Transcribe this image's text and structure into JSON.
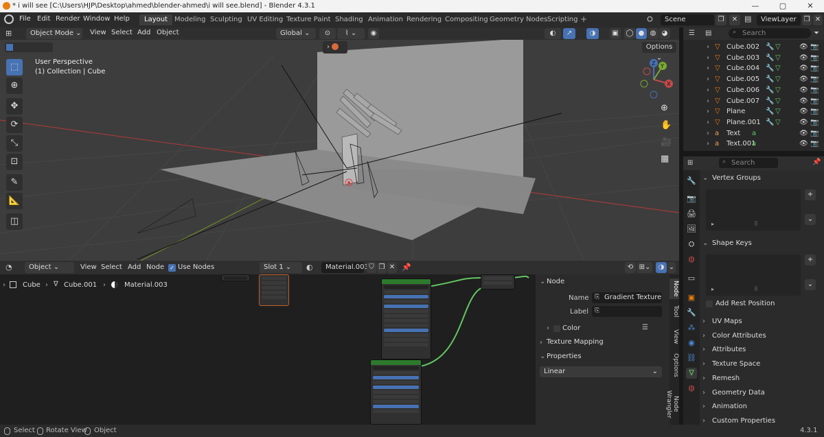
{
  "window": {
    "title": "* i will see [C:\\Users\\HJP\\Desktop\\ahmed\\blender-ahmed\\i will see.blend] - Blender 4.3.1",
    "minimize_glyph": "—",
    "maximize_glyph": "▢",
    "close_glyph": "✕"
  },
  "menu": [
    "File",
    "Edit",
    "Render",
    "Window",
    "Help"
  ],
  "workspaces": [
    "Layout",
    "Modeling",
    "Sculpting",
    "UV Editing",
    "Texture Paint",
    "Shading",
    "Animation",
    "Rendering",
    "Compositing",
    "Geometry Nodes",
    "Scripting"
  ],
  "add_workspace_glyph": "+",
  "scene": {
    "name": "Scene"
  },
  "view_layer": {
    "name": "ViewLayer"
  },
  "viewport": {
    "mode": "Object Mode",
    "menus": [
      "View",
      "Select",
      "Add",
      "Object"
    ],
    "transform_orientation": "Global",
    "view_name": "User Perspective",
    "collection_info": "(1) Collection | Cube",
    "options_label": "Options",
    "gizmo_axes": {
      "z": "Z",
      "y": "Y",
      "x": "X"
    },
    "colors": {
      "background": "#3d3d3d",
      "floor": "#8a8a8a",
      "wall": "#9a9a9a",
      "x_axis": "#a13a3a",
      "y_axis": "#6a8a2a"
    }
  },
  "node_editor": {
    "object_type": "Object",
    "menus": [
      "View",
      "Select",
      "Add",
      "Node"
    ],
    "use_nodes_label": "Use Nodes",
    "slot": "Slot 1",
    "material": "Material.003",
    "breadcrumb": [
      "Cube",
      "Cube.001",
      "Material.003"
    ]
  },
  "node_panel": {
    "tabs": [
      "Node",
      "Tool",
      "View",
      "Options",
      "Node Wrangler"
    ],
    "section_node": "Node",
    "name_label": "Name",
    "name_value": "Gradient Texture",
    "label_label": "Label",
    "label_value": "",
    "color_label": "Color",
    "texture_mapping": "Texture Mapping",
    "properties": "Properties",
    "gradient_type": "Linear"
  },
  "outliner": {
    "search_placeholder": "Search",
    "items": [
      {
        "name": "Cube.002",
        "type": "mesh"
      },
      {
        "name": "Cube.003",
        "type": "mesh"
      },
      {
        "name": "Cube.004",
        "type": "mesh"
      },
      {
        "name": "Cube.005",
        "type": "mesh"
      },
      {
        "name": "Cube.006",
        "type": "mesh"
      },
      {
        "name": "Cube.007",
        "type": "mesh"
      },
      {
        "name": "Plane",
        "type": "mesh"
      },
      {
        "name": "Plane.001",
        "type": "mesh"
      },
      {
        "name": "Text",
        "type": "text"
      },
      {
        "name": "Text.001",
        "type": "text"
      }
    ]
  },
  "properties": {
    "search_placeholder": "Search",
    "vertex_groups": "Vertex Groups",
    "shape_keys": "Shape Keys",
    "add_rest_position": "Add Rest Position",
    "sections": [
      "UV Maps",
      "Color Attributes",
      "Attributes",
      "Texture Space",
      "Remesh",
      "Geometry Data",
      "Animation",
      "Custom Properties"
    ]
  },
  "statusbar": {
    "items": [
      "Select",
      "Rotate View",
      "Object"
    ],
    "version": "4.3.1"
  }
}
